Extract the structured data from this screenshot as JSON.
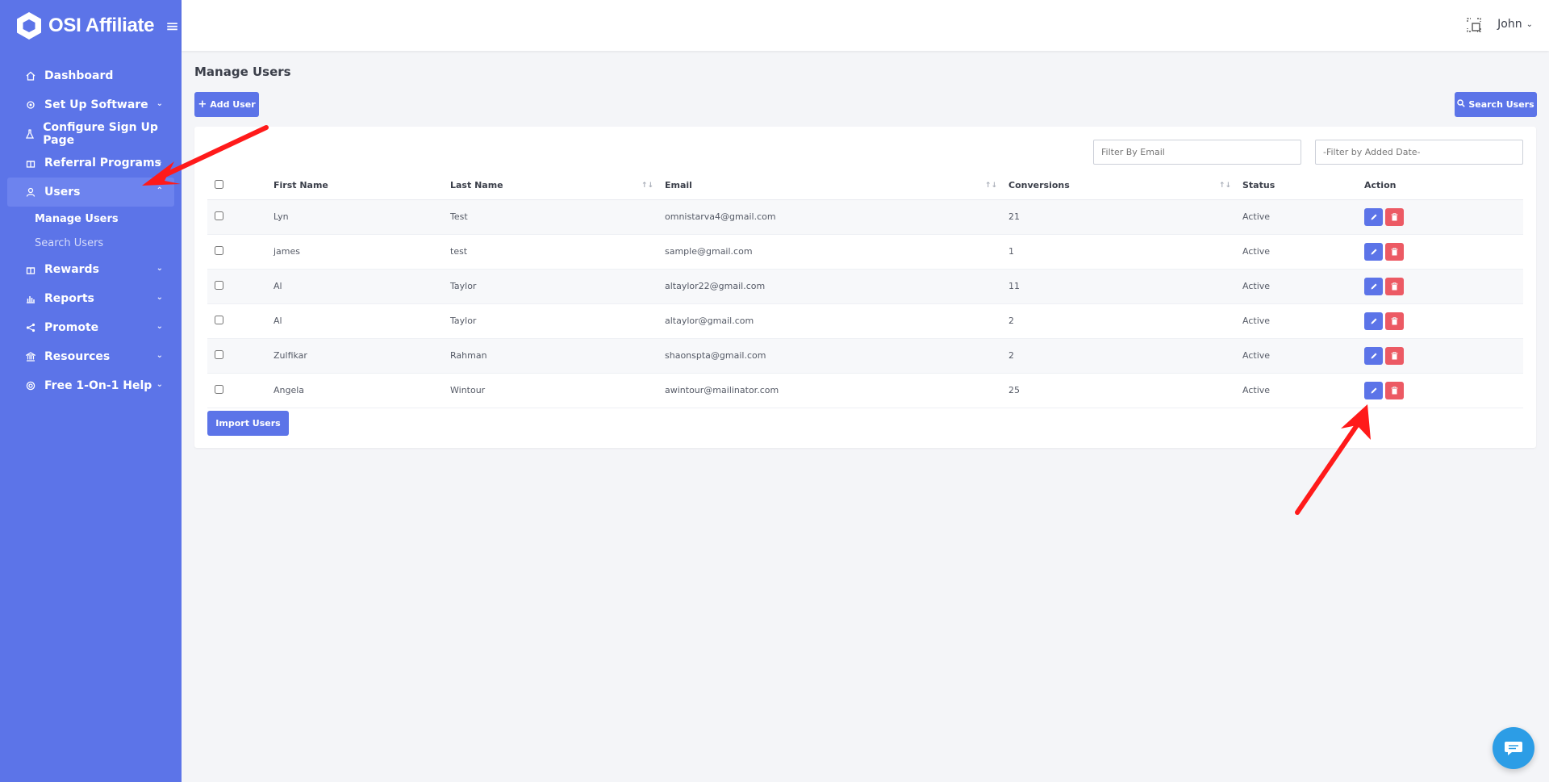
{
  "brand": {
    "name": "OSI Affiliate"
  },
  "sidebar": {
    "items": [
      {
        "label": "Dashboard",
        "icon": "home-icon",
        "has_children": false
      },
      {
        "label": "Set Up Software",
        "icon": "gear-icon",
        "has_children": true
      },
      {
        "label": "Configure Sign Up Page",
        "icon": "flask-icon",
        "has_children": false
      },
      {
        "label": "Referral Programs",
        "icon": "gift-icon",
        "has_children": true
      },
      {
        "label": "Users",
        "icon": "user-icon",
        "has_children": true,
        "expanded": true,
        "children": [
          {
            "label": "Manage Users",
            "current": true
          },
          {
            "label": "Search Users",
            "current": false
          }
        ]
      },
      {
        "label": "Rewards",
        "icon": "gift-icon",
        "has_children": true
      },
      {
        "label": "Reports",
        "icon": "chart-icon",
        "has_children": true
      },
      {
        "label": "Promote",
        "icon": "share-icon",
        "has_children": true
      },
      {
        "label": "Resources",
        "icon": "bank-icon",
        "has_children": true
      },
      {
        "label": "Free 1-On-1 Help",
        "icon": "lifebuoy-icon",
        "has_children": true
      }
    ]
  },
  "header": {
    "user_name": "John"
  },
  "main": {
    "title": "Manage Users",
    "add_user_label": "Add User",
    "search_users_label": "Search Users",
    "filter_email_placeholder": "Filter By Email",
    "filter_date_placeholder": "-Filter by Added Date-",
    "import_label": "Import Users",
    "columns": [
      "First Name",
      "Last Name",
      "Email",
      "Conversions",
      "Status",
      "Action"
    ],
    "rows": [
      {
        "first": "Lyn",
        "last": "Test",
        "email": "omnistarva4@gmail.com",
        "conversions": "21",
        "status": "Active"
      },
      {
        "first": "james",
        "last": "test",
        "email": "sample@gmail.com",
        "conversions": "1",
        "status": "Active"
      },
      {
        "first": "Al",
        "last": "Taylor",
        "email": "altaylor22@gmail.com",
        "conversions": "11",
        "status": "Active"
      },
      {
        "first": "Al",
        "last": "Taylor",
        "email": "altaylor@gmail.com",
        "conversions": "2",
        "status": "Active"
      },
      {
        "first": "Zulfikar",
        "last": "Rahman",
        "email": "shaonspta@gmail.com",
        "conversions": "2",
        "status": "Active"
      },
      {
        "first": "Angela",
        "last": "Wintour",
        "email": "awintour@mailinator.com",
        "conversions": "25",
        "status": "Active"
      }
    ]
  },
  "colors": {
    "primary": "#5c74e8",
    "danger": "#ec5a64",
    "annotation": "#ff1a1a",
    "chat": "#2c9de6"
  }
}
